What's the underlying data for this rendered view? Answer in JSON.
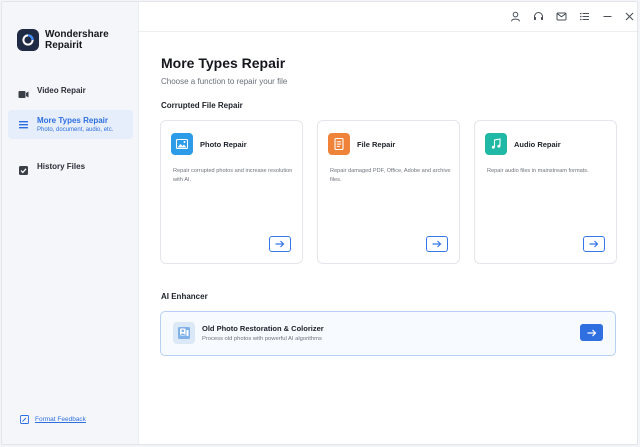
{
  "app": {
    "name_line1": "Wondershare",
    "name_line2": "Repairit"
  },
  "sidebar": {
    "items": [
      {
        "label": "Video Repair",
        "icon": "video-icon"
      },
      {
        "label": "More Types Repair",
        "sub": "Photo, document, audio, etc.",
        "icon": "menu-icon",
        "active": true
      },
      {
        "label": "History Files",
        "icon": "history-icon"
      }
    ],
    "feedback_label": "Format Feedback"
  },
  "topbar": {
    "icons": [
      "user-icon",
      "headset-icon",
      "mail-icon",
      "list-icon",
      "minimize-icon",
      "close-icon"
    ]
  },
  "main": {
    "title": "More Types Repair",
    "subtitle": "Choose a function to repair your file",
    "section1": "Corrupted File Repair",
    "cards": [
      {
        "title": "Photo Repair",
        "desc": "Repair corrupted photos and increase resolution with AI.",
        "icon": "photo-icon",
        "color": "#2c9be8"
      },
      {
        "title": "File Repair",
        "desc": "Repair damaged PDF, Office, Adobe and archive files.",
        "icon": "file-icon",
        "color": "#f0833a"
      },
      {
        "title": "Audio Repair",
        "desc": "Repair audio files in mainstream formats.",
        "icon": "music-icon",
        "color": "#1fb9a6"
      }
    ],
    "section2": "AI Enhancer",
    "enhancer": {
      "title": "Old Photo Restoration & Colorizer",
      "desc": "Process old photos with powerful AI algorithms",
      "icon": "old-photo-icon"
    }
  },
  "colors": {
    "accent": "#2f6fe0",
    "sidebar_bg": "#f5f6fa",
    "active_bg": "#e7eefb"
  }
}
